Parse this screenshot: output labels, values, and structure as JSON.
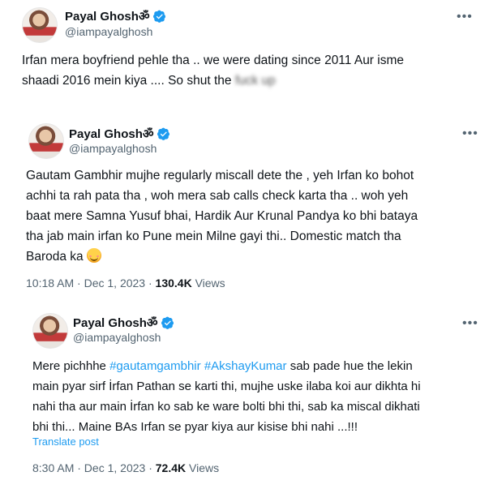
{
  "colors": {
    "link": "#1d9bf0",
    "verified": "#1d9bf0",
    "muted": "#536471",
    "text": "#0f1419"
  },
  "tweet1": {
    "name": "Payal Ghoshॐ",
    "handle": "@iampayalghosh",
    "more_icon": "more-horizontal-icon",
    "text_a": "Irfan mera boyfriend pehle tha .. we were dating since 2011 Aur isme",
    "text_b": "shaadi 2016 mein kiya .... So shut the",
    "text_blurred": "fuck up"
  },
  "tweet2": {
    "name": "Payal Ghoshॐ",
    "handle": "@iampayalghosh",
    "more_icon": "more-horizontal-icon",
    "lines": [
      "Gautam Gambhir mujhe regularly miscall dete  the , yeh Irfan ko bohot",
      "achhi ta rah pata tha , woh mera sab calls check karta tha .. woh yeh",
      "baat mere Samna Yusuf bhai, Hardik  Aur Krunal Pandya ko bhi bataya",
      "tha jab main irfan ko Pune mein Milne gayi thi.. Domestic match tha",
      "Baroda ka"
    ],
    "emoji_icon": "smiling-face-icon",
    "time": "10:18 AM · Dec 1, 2023 ·",
    "views_count": "130.4K",
    "views_label": "Views"
  },
  "tweet3": {
    "name": "Payal Ghoshॐ",
    "handle": "@iampayalghosh",
    "more_icon": "more-horizontal-icon",
    "line1_prefix": "Mere pichhhe",
    "hashtag1": "#gautamgambhir",
    "hashtag2": "#AkshayKumar",
    "line1_suffix": "sab pade hue the lekin",
    "lines": [
      "main pyar sirf İrfan Pathan se karti thi, mujhe uske ilaba koi aur dikhta hi",
      "nahi tha aur main İrfan ko sab ke ware bolti bhi thi, sab ka miscal dikhati",
      "bhi thi... Maine BAs Irfan se pyar kiya aur kisise bhi nahi ...!!!"
    ],
    "translate": "Translate post",
    "time": "8:30 AM · Dec 1, 2023 ·",
    "views_count": "72.4K",
    "views_label": "Views"
  }
}
